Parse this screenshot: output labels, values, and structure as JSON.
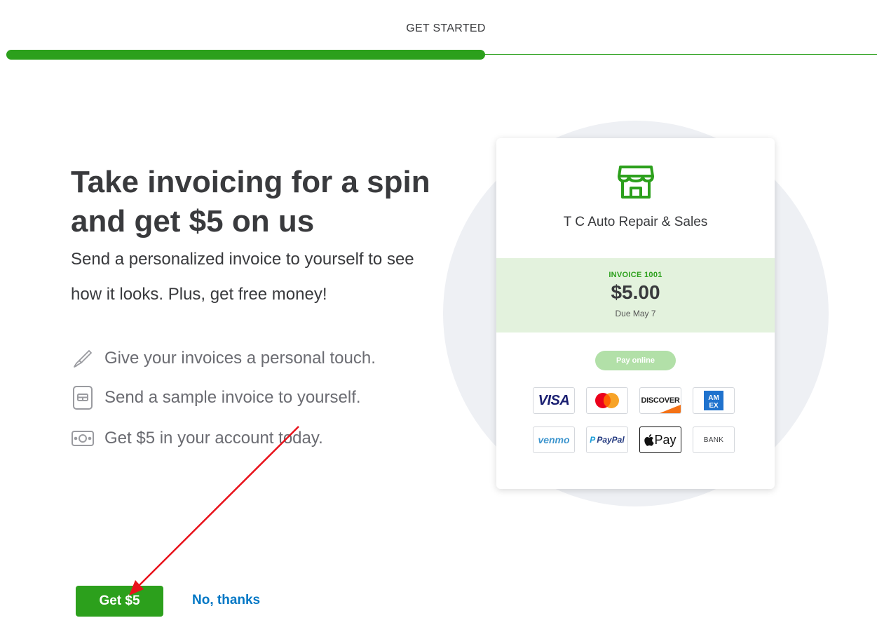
{
  "header": {
    "title": "GET STARTED"
  },
  "progress": {
    "fraction": 0.55
  },
  "main": {
    "headline_line1": "Take invoicing for a spin",
    "headline_line2": "and get $5 on us",
    "subtext": "Send a personalized invoice to yourself to see how it looks. Plus, get free money!",
    "features": [
      {
        "icon": "paintbrush-icon",
        "label": "Give your invoices a personal touch."
      },
      {
        "icon": "invoice-icon",
        "label": "Send a sample invoice to yourself."
      },
      {
        "icon": "money-icon",
        "label": "Get $5 in your account today."
      }
    ]
  },
  "preview": {
    "company_name": "T C Auto Repair & Sales",
    "invoice_number": "INVOICE 1001",
    "amount": "$5.00",
    "due": "Due May 7",
    "pay_online_label": "Pay online",
    "payment_methods": [
      "VISA",
      "Mastercard",
      "DISCOVER",
      "AMEX",
      "venmo",
      "PayPal",
      "Pay",
      "BANK"
    ]
  },
  "actions": {
    "primary_label": "Get $5",
    "secondary_label": "No, thanks"
  },
  "colors": {
    "brand_green": "#2ca01c",
    "link_blue": "#0077c5",
    "annotation_red": "#e8131c"
  }
}
